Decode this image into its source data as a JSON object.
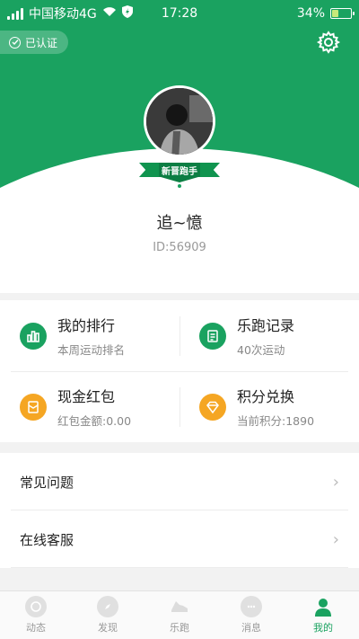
{
  "status_bar": {
    "carrier": "中国移动4G",
    "time": "17:28",
    "battery_percent": "34%",
    "battery_level": 0.34
  },
  "profile": {
    "verified_label": "已认证",
    "badge_title": "新晋跑手",
    "username": "追~憶",
    "user_id": "ID:56909"
  },
  "features": [
    {
      "title": "我的排行",
      "subtitle": "本周运动排名",
      "icon": "bar-chart-icon",
      "color": "#1aa260"
    },
    {
      "title": "乐跑记录",
      "subtitle": "40次运动",
      "icon": "document-icon",
      "color": "#1aa260"
    },
    {
      "title": "现金红包",
      "subtitle": "红包金额:0.00",
      "icon": "red-packet-icon",
      "color": "#f5a623"
    },
    {
      "title": "积分兑换",
      "subtitle": "当前积分:1890",
      "icon": "diamond-icon",
      "color": "#f5a623"
    }
  ],
  "menu": [
    {
      "label": "常见问题"
    },
    {
      "label": "在线客服"
    }
  ],
  "tabs": [
    {
      "label": "动态",
      "icon": "feed-icon"
    },
    {
      "label": "发现",
      "icon": "compass-icon"
    },
    {
      "label": "乐跑",
      "icon": "running-shoe-icon"
    },
    {
      "label": "消息",
      "icon": "message-icon"
    },
    {
      "label": "我的",
      "icon": "person-icon"
    }
  ],
  "colors": {
    "primary": "#1aa260",
    "accent": "#f5a623"
  }
}
